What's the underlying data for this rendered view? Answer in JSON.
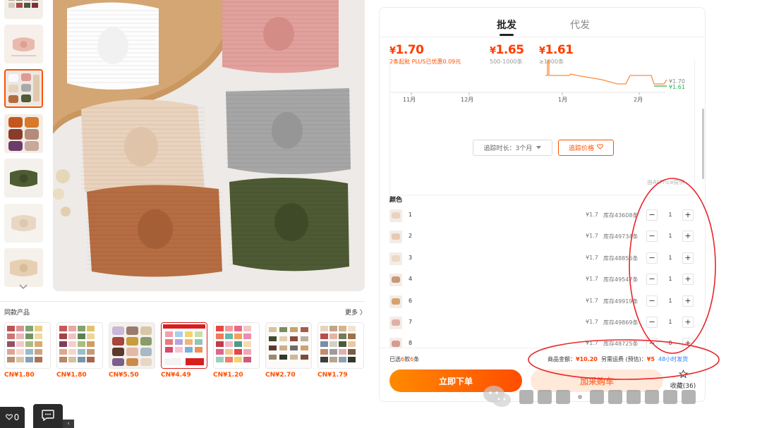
{
  "gallery": {
    "thumbnails": [
      {
        "kind": "grid",
        "active": false
      },
      {
        "kind": "pink-bow",
        "active": false
      },
      {
        "kind": "multi",
        "active": true
      },
      {
        "kind": "brown-purple",
        "active": false
      },
      {
        "kind": "olive",
        "active": false
      },
      {
        "kind": "beige",
        "active": false
      },
      {
        "kind": "tan",
        "active": false
      }
    ],
    "more_icon": "chevron-down-icon"
  },
  "similar": {
    "title": "同款产品",
    "more_label": "更多 〉",
    "items": [
      {
        "price": "CN¥1.80"
      },
      {
        "price": "CN¥1.80"
      },
      {
        "price": "CN¥5.50"
      },
      {
        "price": "CN¥4.49"
      },
      {
        "price": "CN¥1.20"
      },
      {
        "price": "CN¥2.70"
      },
      {
        "price": "CN¥1.79"
      }
    ]
  },
  "floating": {
    "favorites_count": "0"
  },
  "tabs": {
    "wholesale": "批发",
    "dropship": "代发"
  },
  "price_tiers": [
    {
      "price": "1.70",
      "currency": "¥",
      "note": "2条起批 PLUS已优惠0.09元"
    },
    {
      "price": "1.65",
      "currency": "¥",
      "note": "500-1000条"
    },
    {
      "price": "1.61",
      "currency": "¥",
      "note": "≥1000条"
    }
  ],
  "chart_data": {
    "type": "line",
    "x_ticks": [
      "11月",
      "12月",
      "1月",
      "2月"
    ],
    "series": [
      {
        "end_label": "¥1.70",
        "color": "#ff8a3d"
      },
      {
        "end_label": "¥1.61",
        "color": "#2bb24c"
      }
    ]
  },
  "price_tracking": {
    "duration_label": "追踪时长：3个月",
    "track_button": "追踪价格",
    "provider": "由AliPrice提供"
  },
  "color_section": {
    "heading": "颜色",
    "skus": [
      {
        "name": "1",
        "price": "¥1.7",
        "stock": "库存43608条",
        "qty": "1",
        "swatch": "#e9d3c0"
      },
      {
        "name": "2",
        "price": "¥1.7",
        "stock": "库存49734条",
        "qty": "1",
        "swatch": "#e8c9b4"
      },
      {
        "name": "3",
        "price": "¥1.7",
        "stock": "库存48856条",
        "qty": "1",
        "swatch": "#ecd8c6"
      },
      {
        "name": "4",
        "price": "¥1.7",
        "stock": "库存49547条",
        "qty": "1",
        "swatch": "#c49a7c"
      },
      {
        "name": "6",
        "price": "¥1.7",
        "stock": "库存49919条",
        "qty": "1",
        "swatch": "#d6a26b"
      },
      {
        "name": "7",
        "price": "¥1.7",
        "stock": "库存49869条",
        "qty": "1",
        "swatch": "#e0b0a8"
      },
      {
        "name": "8",
        "price": "¥1.7",
        "stock": "库存48725条",
        "qty": "0",
        "swatch": "#d99a92"
      }
    ]
  },
  "summary": {
    "selected_prefix": "已选",
    "selected_styles": "6",
    "selected_mid": "款",
    "selected_items": "6",
    "selected_suffix": "条",
    "amount_label": "商品金额：",
    "amount_value": "¥10.20",
    "shipping_label": "另需运费 (预估)：",
    "shipping_value": "¥5",
    "ship_time": "48小时发货"
  },
  "actions": {
    "buy_now": "立即下单",
    "add_cart": "加采购车",
    "favorite": "收藏(36)"
  },
  "watermark": {
    "text": "公众号 · 跨境电商超仔"
  },
  "colors": {
    "accent": "#ff5000",
    "price_red": "#ff3c00",
    "annotation": "#e8262a"
  }
}
